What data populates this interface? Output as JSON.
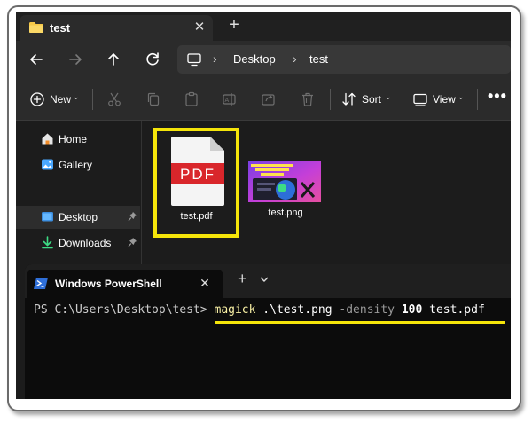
{
  "explorer": {
    "tab_title": "test",
    "tab_close": "✕",
    "new_tab": "+",
    "breadcrumb": {
      "sep": "›",
      "items": [
        "Desktop",
        "test"
      ]
    },
    "commands": {
      "new": "New",
      "sort": "Sort",
      "view": "View",
      "more": "•••",
      "chevron": "⌄"
    },
    "sidebar": {
      "items": [
        {
          "label": "Home"
        },
        {
          "label": "Gallery"
        },
        {
          "label": "Desktop",
          "selected": true
        },
        {
          "label": "Downloads"
        }
      ]
    },
    "files": [
      {
        "name": "test.pdf",
        "badge": "PDF",
        "selected": true
      },
      {
        "name": "test.png"
      }
    ]
  },
  "terminal": {
    "tab_title": "Windows PowerShell",
    "tab_close": "✕",
    "new_tab": "+",
    "prompt": "PS C:\\Users\\Desktop\\test> ",
    "command": "magick",
    "arg1": " .\\test.png ",
    "param": "-density",
    "value": " 100",
    "arg2": " test.pdf"
  },
  "colors": {
    "highlight": "#f5e50a",
    "pdf_red": "#d9262b",
    "folder_yellow": "#f7c948",
    "accent_blue": "#4aa8ff"
  }
}
